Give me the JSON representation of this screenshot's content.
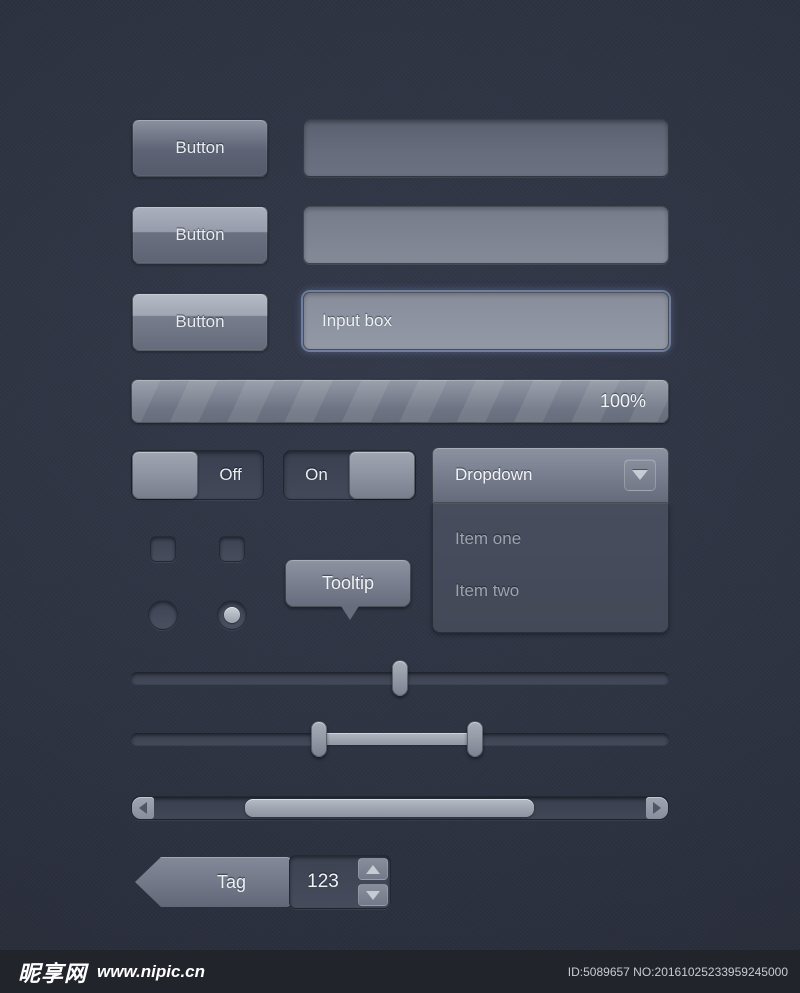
{
  "theme": {
    "background": "#2e3342",
    "surface": "#7a8090",
    "text": "#eef1f6",
    "muted_text": "#9ea4b1",
    "focus_glow": "#96a8cd"
  },
  "buttons": [
    {
      "label": "Button",
      "state": "normal"
    },
    {
      "label": "Button",
      "state": "hover"
    },
    {
      "label": "Button",
      "state": "active"
    }
  ],
  "fields": [
    {
      "value": "",
      "placeholder": "",
      "state": "default"
    },
    {
      "value": "",
      "placeholder": "",
      "state": "hover"
    },
    {
      "value": "Input box",
      "placeholder": "Input box",
      "state": "focused"
    }
  ],
  "progress": {
    "label": "100%",
    "value": 100,
    "max": 100
  },
  "toggles": [
    {
      "label": "Off",
      "checked": false,
      "knob_side": "left"
    },
    {
      "label": "On",
      "checked": true,
      "knob_side": "right"
    }
  ],
  "dropdown": {
    "label": "Dropdown",
    "arrow_icon": "chevron-down-icon",
    "items": [
      {
        "label": "Item one"
      },
      {
        "label": "Item two"
      }
    ]
  },
  "checkboxes": [
    {
      "checked": false
    },
    {
      "checked": false
    }
  ],
  "radios": [
    {
      "checked": false
    },
    {
      "checked": true
    }
  ],
  "tooltip": {
    "label": "Tooltip"
  },
  "sliders": [
    {
      "type": "single",
      "value": 50
    },
    {
      "type": "range",
      "low": 35,
      "high": 64
    }
  ],
  "scrollbar": {
    "left_arrow_icon": "arrow-left-icon",
    "right_arrow_icon": "arrow-right-icon",
    "thumb_start": 21,
    "thumb_end": 75
  },
  "tag": {
    "label": "Tag"
  },
  "spinner": {
    "value": "123",
    "up_icon": "arrow-up-icon",
    "down_icon": "arrow-down-icon"
  },
  "footer": {
    "logo": "昵享网",
    "url": "www.nipic.cn",
    "id_text": "ID:5089657 NO:20161025233959245000"
  }
}
